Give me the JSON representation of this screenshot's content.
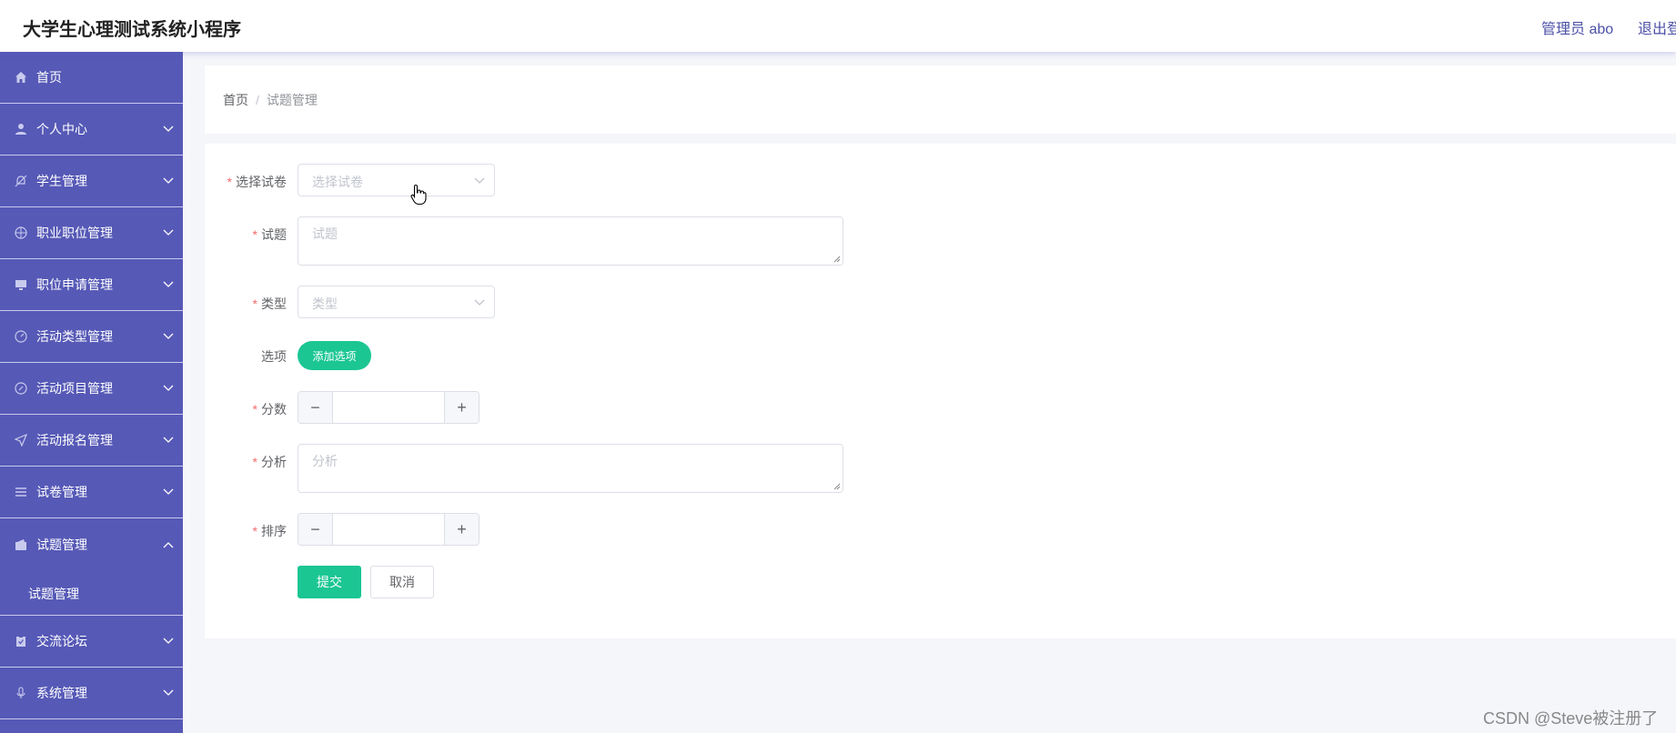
{
  "header": {
    "title": "大学生心理测试系统小程序",
    "user": "管理员 abo",
    "logout": "退出登"
  },
  "sidebar": {
    "items": [
      {
        "label": "首页",
        "icon": "home-icon",
        "expandable": false
      },
      {
        "label": "个人中心",
        "icon": "user-icon",
        "expandable": true
      },
      {
        "label": "学生管理",
        "icon": "bell-off-icon",
        "expandable": true
      },
      {
        "label": "职业职位管理",
        "icon": "basketball-icon",
        "expandable": true
      },
      {
        "label": "职位申请管理",
        "icon": "monitor-icon",
        "expandable": true
      },
      {
        "label": "活动类型管理",
        "icon": "gauge-icon",
        "expandable": true
      },
      {
        "label": "活动项目管理",
        "icon": "compass-icon",
        "expandable": true
      },
      {
        "label": "活动报名管理",
        "icon": "send-icon",
        "expandable": true
      },
      {
        "label": "试卷管理",
        "icon": "list-icon",
        "expandable": true
      },
      {
        "label": "试题管理",
        "icon": "wallet-icon",
        "expandable": true,
        "expanded": true
      },
      {
        "label": "交流论坛",
        "icon": "clipboard-icon",
        "expandable": true
      },
      {
        "label": "系统管理",
        "icon": "microphone-icon",
        "expandable": true
      }
    ],
    "submenu": {
      "label": "试题管理"
    }
  },
  "breadcrumb": {
    "home": "首页",
    "separator": "/",
    "current": "试题管理"
  },
  "form": {
    "paper": {
      "label": "选择试卷",
      "placeholder": "选择试卷",
      "required": true
    },
    "question": {
      "label": "试题",
      "placeholder": "试题",
      "required": true
    },
    "type": {
      "label": "类型",
      "placeholder": "类型",
      "required": true
    },
    "options": {
      "label": "选项",
      "button": "添加选项",
      "required": false
    },
    "score": {
      "label": "分数",
      "value": "",
      "required": true
    },
    "analysis": {
      "label": "分析",
      "placeholder": "分析",
      "required": true
    },
    "order": {
      "label": "排序",
      "value": "",
      "required": true
    },
    "submit": "提交",
    "cancel": "取消",
    "required_mark": "*",
    "minus": "−",
    "plus": "+"
  },
  "watermark": "CSDN @Steve被注册了",
  "colors": {
    "sidebar": "#5659b6",
    "accent": "#1bc693",
    "required": "#f56c6c"
  }
}
